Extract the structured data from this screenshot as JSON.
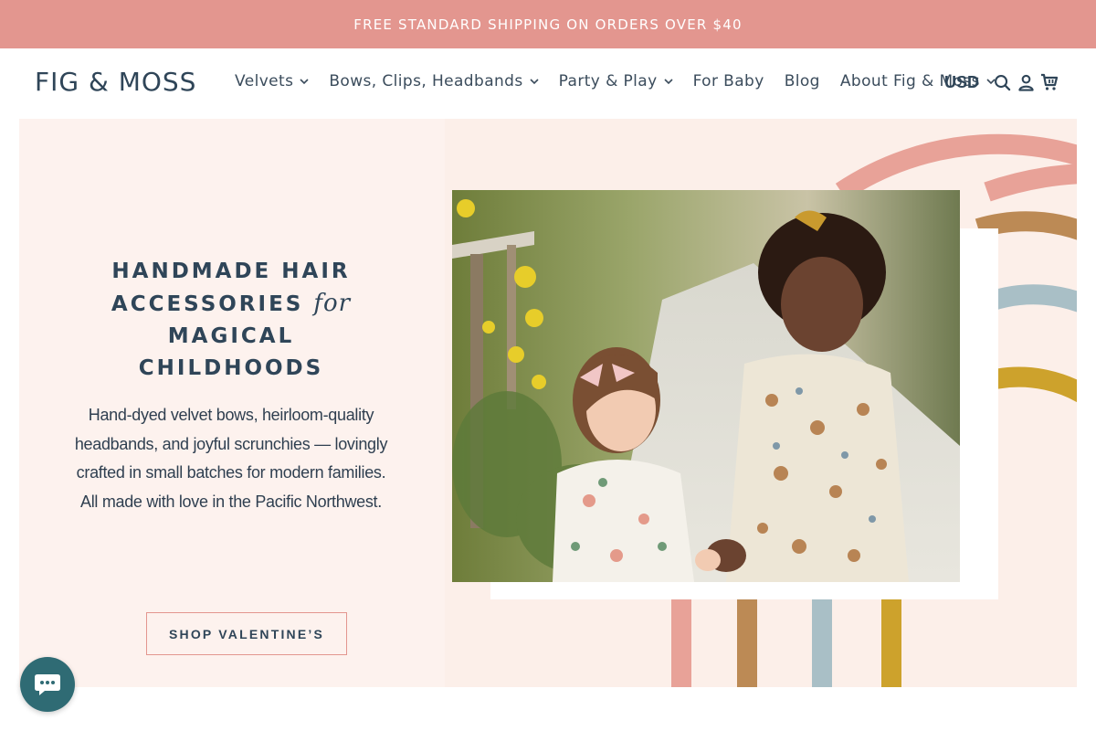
{
  "announcement": "FREE STANDARD SHIPPING ON ORDERS OVER $40",
  "header": {
    "logo": "FIG & MOSS",
    "nav": [
      {
        "label": "Velvets",
        "dropdown": true
      },
      {
        "label": "Bows, Clips, Headbands",
        "dropdown": true
      },
      {
        "label": "Party & Play",
        "dropdown": true
      },
      {
        "label": "For Baby",
        "dropdown": false
      },
      {
        "label": "Blog",
        "dropdown": false
      },
      {
        "label": "About Fig & Moss",
        "dropdown": true
      }
    ],
    "currency": "USD",
    "icons": [
      "search-icon",
      "account-icon",
      "cart-icon"
    ]
  },
  "hero": {
    "headline_lines": [
      "HANDMADE HAIR",
      "ACCESSORIES",
      "for",
      "MAGICAL",
      "CHILDHOODS"
    ],
    "blurb": "Hand-dyed velvet bows, heirloom-quality headbands, and joyful scrunchies — lovingly crafted in small batches for modern families. All made with love in the Pacific Northwest.",
    "cta": "SHOP VALENTINE’S",
    "photo_alt": "two-girls-photo"
  },
  "colors": {
    "announcement_bg": "#e3968f",
    "hero_bg": "#fdf2ee",
    "brand_navy": "#2f4558",
    "stripe_pink": "#e8a298",
    "stripe_tan": "#bc8a55",
    "stripe_blue": "#a9bfc6",
    "stripe_mustard": "#cda22c",
    "chat_bg": "#2f6b74"
  },
  "chat": {
    "icon": "chat-icon"
  }
}
